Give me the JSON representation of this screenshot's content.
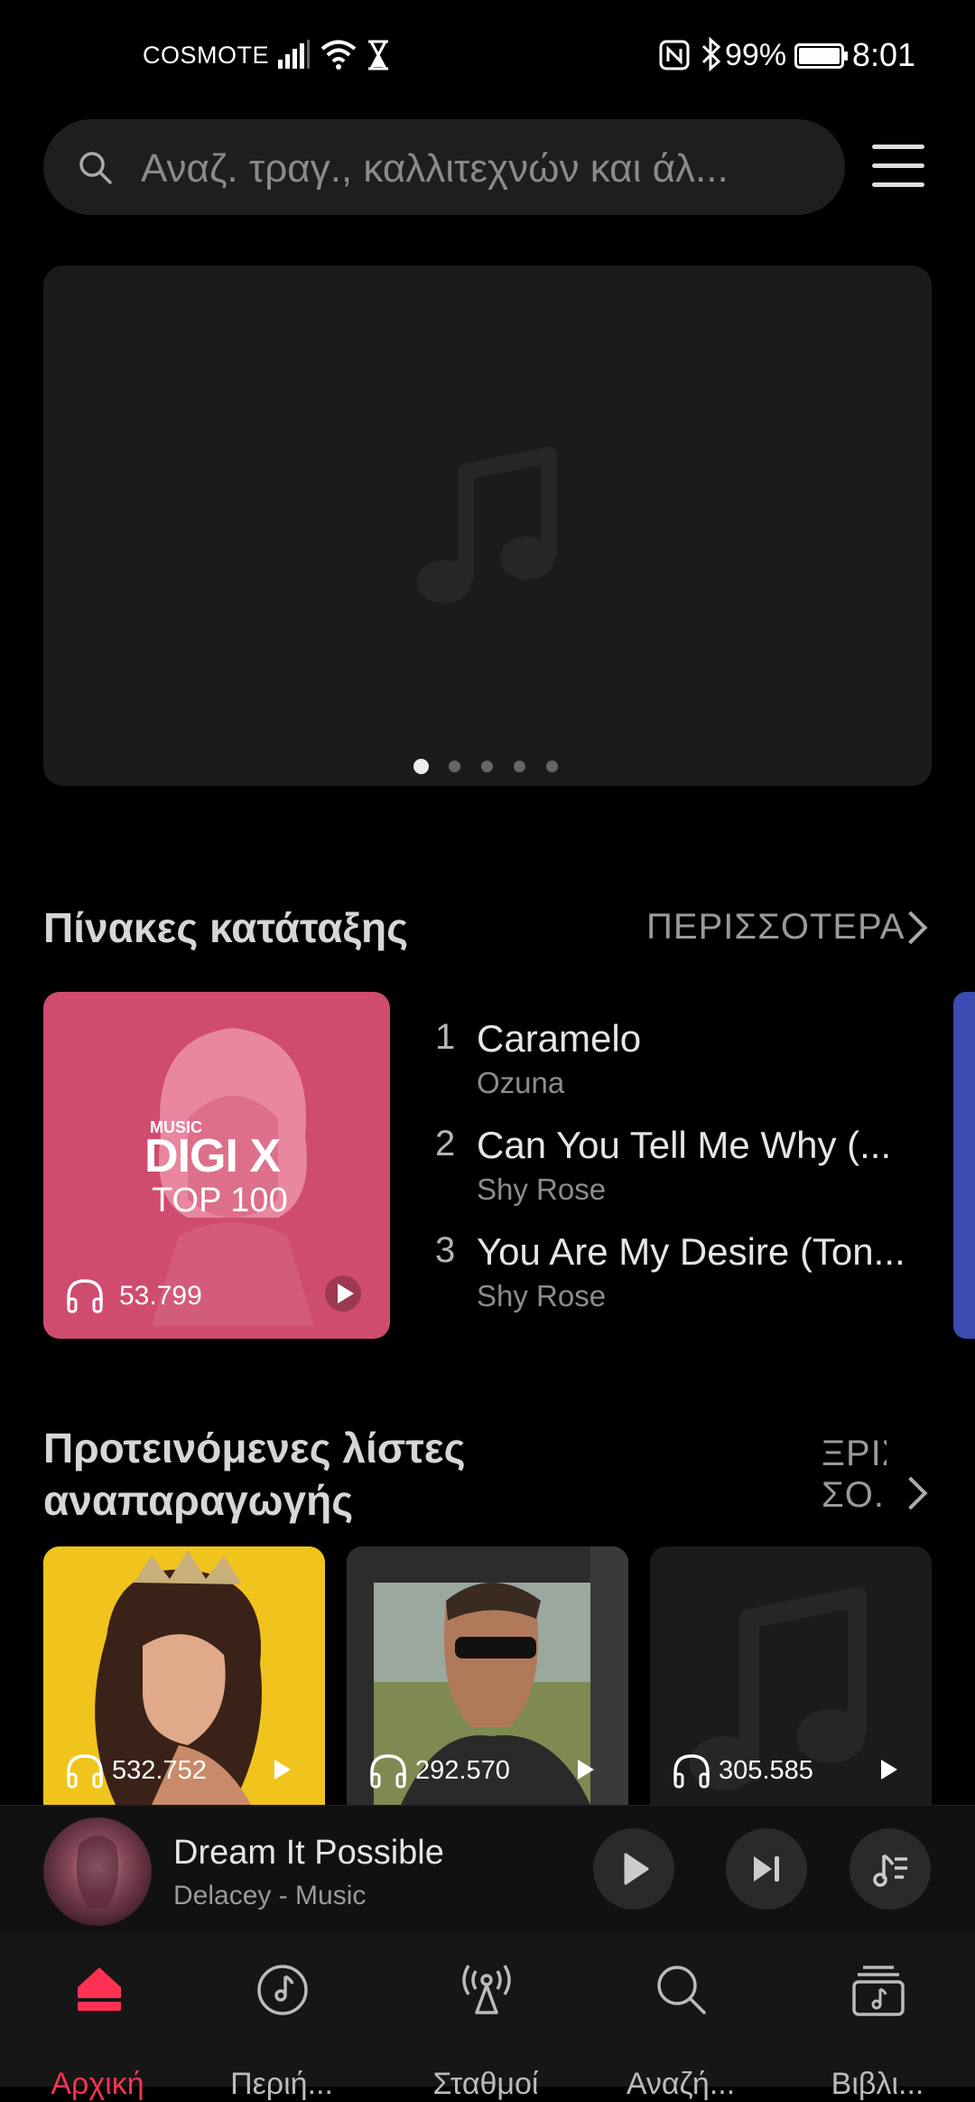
{
  "status_bar": {
    "carrier": "COSMOTE",
    "battery": "99%",
    "time": "8:01",
    "icons": [
      "signal-icon",
      "wifi-icon",
      "hourglass-icon",
      "nfc-icon",
      "bluetooth-icon",
      "battery-icon"
    ]
  },
  "search": {
    "placeholder": "Αναζ. τραγ., καλλιτεχνών και άλ..."
  },
  "banner": {
    "page_count": 5,
    "active_page": 1
  },
  "charts_section": {
    "title": "Πίνακες κατάταξης",
    "more": "ΠΕΡΙΣΣΟΤΕΡΑ",
    "cover": {
      "brand_small": "MUSIC",
      "brand": "DIGI X",
      "subtitle": "TOP 100",
      "listens": "53.799"
    },
    "tracks": [
      {
        "rank": "1",
        "title": "Caramelo",
        "artist": "Ozuna"
      },
      {
        "rank": "2",
        "title": "Can You Tell Me Why (...",
        "artist": "Shy Rose"
      },
      {
        "rank": "3",
        "title": "You Are My Desire (Ton...",
        "artist": "Shy Rose"
      }
    ]
  },
  "playlists_section": {
    "title_line1": "Προτεινόμενες λίστες",
    "title_line2": "αναπαραγωγής",
    "more_line1": "ΞΡΙΣ",
    "more_line2": "ΣΟ...",
    "items": [
      {
        "listens": "532.752"
      },
      {
        "listens": "292.570"
      },
      {
        "listens": "305.585"
      }
    ]
  },
  "now_playing": {
    "title": "Dream It Possible",
    "artist": "Delacey - Music"
  },
  "bottom_nav": {
    "items": [
      {
        "label": "Αρχική",
        "icon": "home-icon",
        "active": true
      },
      {
        "label": "Περιή...",
        "icon": "music-disc-icon",
        "active": false
      },
      {
        "label": "Σταθμοί",
        "icon": "radio-tower-icon",
        "active": false
      },
      {
        "label": "Αναζή...",
        "icon": "search-icon",
        "active": false
      },
      {
        "label": "Βιβλι...",
        "icon": "library-icon",
        "active": false
      }
    ],
    "active_color": "#ff3153"
  }
}
